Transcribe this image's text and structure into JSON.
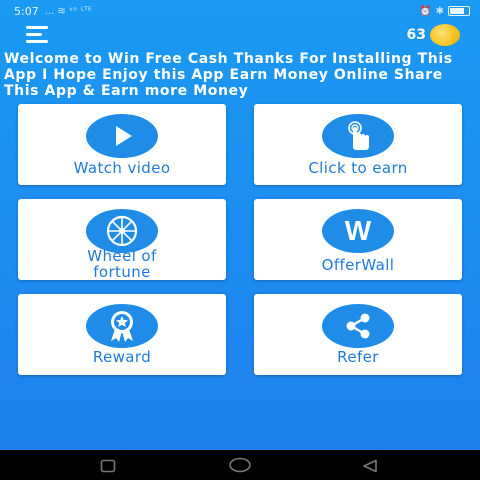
{
  "status_bar": {
    "time": "5:07",
    "signal_glyphs": "...  ≋  ᵛᵒ ᴸᵀᴱ"
  },
  "app_bar": {
    "coin_count": "63"
  },
  "welcome_text": "Welcome to Win Free Cash Thanks For Installing This App I Hope Enjoy this App Earn Money Online Share This App & Earn more Money",
  "cards": {
    "watch_video": {
      "label": "Watch video",
      "icon": "play-icon"
    },
    "click_to_earn": {
      "label": "Click to earn",
      "icon": "tap-hand-icon"
    },
    "wheel_of_fortune": {
      "label": "Wheel of fortune",
      "icon": "wheel-icon"
    },
    "offerwall": {
      "label": "OfferWall",
      "icon": "w-letter-icon"
    },
    "reward": {
      "label": "Reward",
      "icon": "badge-icon"
    },
    "refer": {
      "label": "Refer",
      "icon": "share-icon"
    }
  },
  "colors": {
    "background": "#1c8ff0",
    "card": "#ffffff",
    "icon_circle": "#1f8de7",
    "label": "#1f7ad8",
    "coin": "#f6c21b"
  },
  "nav_bar": {
    "buttons": [
      "recent-apps-icon",
      "home-icon",
      "back-icon"
    ]
  }
}
